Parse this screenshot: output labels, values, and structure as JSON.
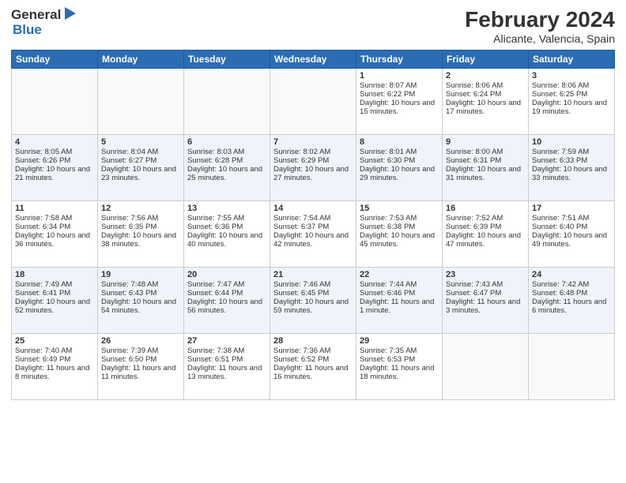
{
  "header": {
    "logo_general": "General",
    "logo_blue": "Blue",
    "month_year": "February 2024",
    "location": "Alicante, Valencia, Spain"
  },
  "days_of_week": [
    "Sunday",
    "Monday",
    "Tuesday",
    "Wednesday",
    "Thursday",
    "Friday",
    "Saturday"
  ],
  "weeks": [
    [
      {
        "day": "",
        "sunrise": "",
        "sunset": "",
        "daylight": "",
        "empty": true
      },
      {
        "day": "",
        "sunrise": "",
        "sunset": "",
        "daylight": "",
        "empty": true
      },
      {
        "day": "",
        "sunrise": "",
        "sunset": "",
        "daylight": "",
        "empty": true
      },
      {
        "day": "",
        "sunrise": "",
        "sunset": "",
        "daylight": "",
        "empty": true
      },
      {
        "day": "1",
        "sunrise": "Sunrise: 8:07 AM",
        "sunset": "Sunset: 6:22 PM",
        "daylight": "Daylight: 10 hours and 15 minutes."
      },
      {
        "day": "2",
        "sunrise": "Sunrise: 8:06 AM",
        "sunset": "Sunset: 6:24 PM",
        "daylight": "Daylight: 10 hours and 17 minutes."
      },
      {
        "day": "3",
        "sunrise": "Sunrise: 8:06 AM",
        "sunset": "Sunset: 6:25 PM",
        "daylight": "Daylight: 10 hours and 19 minutes."
      }
    ],
    [
      {
        "day": "4",
        "sunrise": "Sunrise: 8:05 AM",
        "sunset": "Sunset: 6:26 PM",
        "daylight": "Daylight: 10 hours and 21 minutes."
      },
      {
        "day": "5",
        "sunrise": "Sunrise: 8:04 AM",
        "sunset": "Sunset: 6:27 PM",
        "daylight": "Daylight: 10 hours and 23 minutes."
      },
      {
        "day": "6",
        "sunrise": "Sunrise: 8:03 AM",
        "sunset": "Sunset: 6:28 PM",
        "daylight": "Daylight: 10 hours and 25 minutes."
      },
      {
        "day": "7",
        "sunrise": "Sunrise: 8:02 AM",
        "sunset": "Sunset: 6:29 PM",
        "daylight": "Daylight: 10 hours and 27 minutes."
      },
      {
        "day": "8",
        "sunrise": "Sunrise: 8:01 AM",
        "sunset": "Sunset: 6:30 PM",
        "daylight": "Daylight: 10 hours and 29 minutes."
      },
      {
        "day": "9",
        "sunrise": "Sunrise: 8:00 AM",
        "sunset": "Sunset: 6:31 PM",
        "daylight": "Daylight: 10 hours and 31 minutes."
      },
      {
        "day": "10",
        "sunrise": "Sunrise: 7:59 AM",
        "sunset": "Sunset: 6:33 PM",
        "daylight": "Daylight: 10 hours and 33 minutes."
      }
    ],
    [
      {
        "day": "11",
        "sunrise": "Sunrise: 7:58 AM",
        "sunset": "Sunset: 6:34 PM",
        "daylight": "Daylight: 10 hours and 36 minutes."
      },
      {
        "day": "12",
        "sunrise": "Sunrise: 7:56 AM",
        "sunset": "Sunset: 6:35 PM",
        "daylight": "Daylight: 10 hours and 38 minutes."
      },
      {
        "day": "13",
        "sunrise": "Sunrise: 7:55 AM",
        "sunset": "Sunset: 6:36 PM",
        "daylight": "Daylight: 10 hours and 40 minutes."
      },
      {
        "day": "14",
        "sunrise": "Sunrise: 7:54 AM",
        "sunset": "Sunset: 6:37 PM",
        "daylight": "Daylight: 10 hours and 42 minutes."
      },
      {
        "day": "15",
        "sunrise": "Sunrise: 7:53 AM",
        "sunset": "Sunset: 6:38 PM",
        "daylight": "Daylight: 10 hours and 45 minutes."
      },
      {
        "day": "16",
        "sunrise": "Sunrise: 7:52 AM",
        "sunset": "Sunset: 6:39 PM",
        "daylight": "Daylight: 10 hours and 47 minutes."
      },
      {
        "day": "17",
        "sunrise": "Sunrise: 7:51 AM",
        "sunset": "Sunset: 6:40 PM",
        "daylight": "Daylight: 10 hours and 49 minutes."
      }
    ],
    [
      {
        "day": "18",
        "sunrise": "Sunrise: 7:49 AM",
        "sunset": "Sunset: 6:41 PM",
        "daylight": "Daylight: 10 hours and 52 minutes."
      },
      {
        "day": "19",
        "sunrise": "Sunrise: 7:48 AM",
        "sunset": "Sunset: 6:43 PM",
        "daylight": "Daylight: 10 hours and 54 minutes."
      },
      {
        "day": "20",
        "sunrise": "Sunrise: 7:47 AM",
        "sunset": "Sunset: 6:44 PM",
        "daylight": "Daylight: 10 hours and 56 minutes."
      },
      {
        "day": "21",
        "sunrise": "Sunrise: 7:46 AM",
        "sunset": "Sunset: 6:45 PM",
        "daylight": "Daylight: 10 hours and 59 minutes."
      },
      {
        "day": "22",
        "sunrise": "Sunrise: 7:44 AM",
        "sunset": "Sunset: 6:46 PM",
        "daylight": "Daylight: 11 hours and 1 minute."
      },
      {
        "day": "23",
        "sunrise": "Sunrise: 7:43 AM",
        "sunset": "Sunset: 6:47 PM",
        "daylight": "Daylight: 11 hours and 3 minutes."
      },
      {
        "day": "24",
        "sunrise": "Sunrise: 7:42 AM",
        "sunset": "Sunset: 6:48 PM",
        "daylight": "Daylight: 11 hours and 6 minutes."
      }
    ],
    [
      {
        "day": "25",
        "sunrise": "Sunrise: 7:40 AM",
        "sunset": "Sunset: 6:49 PM",
        "daylight": "Daylight: 11 hours and 8 minutes."
      },
      {
        "day": "26",
        "sunrise": "Sunrise: 7:39 AM",
        "sunset": "Sunset: 6:50 PM",
        "daylight": "Daylight: 11 hours and 11 minutes."
      },
      {
        "day": "27",
        "sunrise": "Sunrise: 7:38 AM",
        "sunset": "Sunset: 6:51 PM",
        "daylight": "Daylight: 11 hours and 13 minutes."
      },
      {
        "day": "28",
        "sunrise": "Sunrise: 7:36 AM",
        "sunset": "Sunset: 6:52 PM",
        "daylight": "Daylight: 11 hours and 16 minutes."
      },
      {
        "day": "29",
        "sunrise": "Sunrise: 7:35 AM",
        "sunset": "Sunset: 6:53 PM",
        "daylight": "Daylight: 11 hours and 18 minutes."
      },
      {
        "day": "",
        "sunrise": "",
        "sunset": "",
        "daylight": "",
        "empty": true
      },
      {
        "day": "",
        "sunrise": "",
        "sunset": "",
        "daylight": "",
        "empty": true
      }
    ]
  ]
}
